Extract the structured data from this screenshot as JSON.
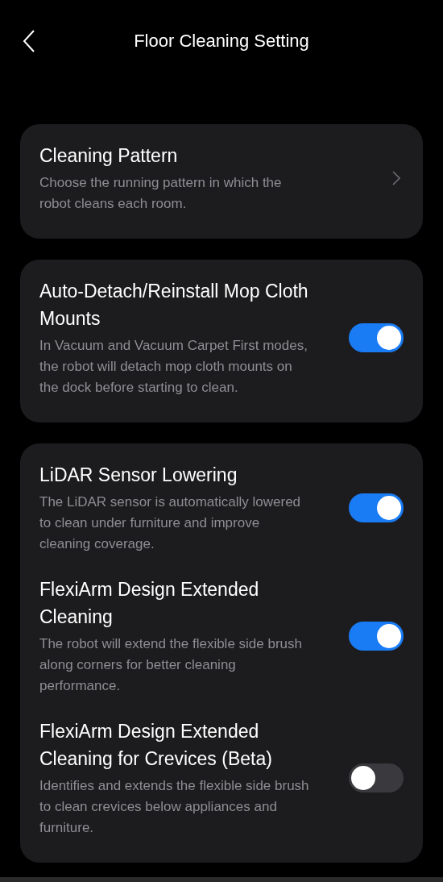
{
  "header": {
    "title": "Floor Cleaning Setting"
  },
  "cards": [
    {
      "items": [
        {
          "kind": "link",
          "title": "Cleaning Pattern",
          "description": "Choose the running pattern in which the robot cleans each room."
        }
      ]
    },
    {
      "items": [
        {
          "kind": "toggle",
          "title": "Auto-Detach/Reinstall Mop Cloth Mounts",
          "description": "In Vacuum and Vacuum Carpet First modes, the robot will detach mop cloth mounts on the dock before starting to clean.",
          "on": true
        }
      ]
    },
    {
      "items": [
        {
          "kind": "toggle",
          "title": "LiDAR Sensor Lowering",
          "description": "The LiDAR sensor is automatically lowered to clean under furniture and improve cleaning coverage.",
          "on": true
        },
        {
          "kind": "toggle",
          "title": "FlexiArm Design Extended Cleaning",
          "description": "The robot will extend the flexible side brush along corners for better cleaning performance.",
          "on": true
        },
        {
          "kind": "toggle",
          "title": "FlexiArm Design Extended Cleaning for Crevices (Beta)",
          "description": "Identifies and extends the flexible side brush to clean crevices below appliances and furniture.",
          "on": false
        }
      ]
    }
  ]
}
